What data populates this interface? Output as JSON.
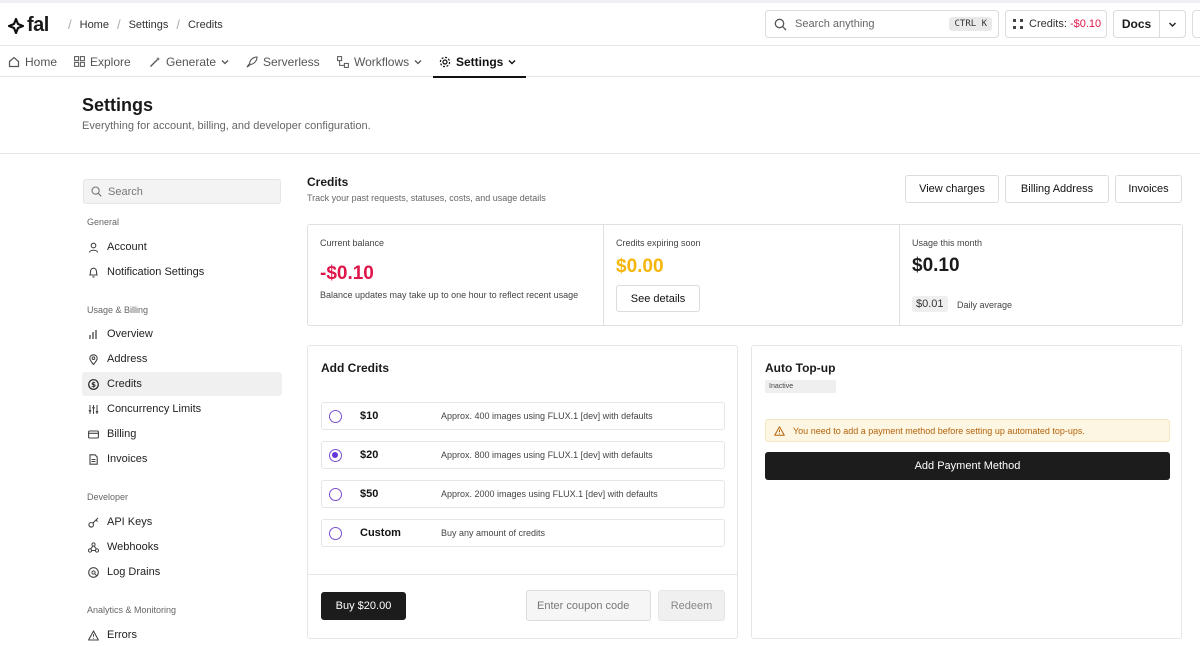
{
  "brand": {
    "name": "fal"
  },
  "breadcrumb": [
    "Home",
    "Settings",
    "Credits"
  ],
  "topbar": {
    "search_placeholder": "Search anything",
    "shortcut": "CTRL K",
    "credits_label": "Credits:",
    "credits_value": "-$0.10",
    "docs_label": "Docs"
  },
  "nav": [
    {
      "label": "Home",
      "icon": "home-icon"
    },
    {
      "label": "Explore",
      "icon": "grid-icon"
    },
    {
      "label": "Generate",
      "icon": "wand-icon",
      "dropdown": true
    },
    {
      "label": "Serverless",
      "icon": "rocket-icon"
    },
    {
      "label": "Workflows",
      "icon": "workflow-icon",
      "dropdown": true
    },
    {
      "label": "Settings",
      "icon": "gear-icon",
      "dropdown": true,
      "active": true
    }
  ],
  "page": {
    "title": "Settings",
    "subtitle": "Everything for account, billing, and developer configuration."
  },
  "sidebar": {
    "search_placeholder": "Search",
    "groups": [
      {
        "label": "General",
        "items": [
          {
            "label": "Account",
            "icon": "user-icon"
          },
          {
            "label": "Notification Settings",
            "icon": "bell-icon"
          }
        ]
      },
      {
        "label": "Usage & Billing",
        "items": [
          {
            "label": "Overview",
            "icon": "bar-chart-icon"
          },
          {
            "label": "Address",
            "icon": "map-pin-icon"
          },
          {
            "label": "Credits",
            "icon": "dollar-circle-icon",
            "active": true
          },
          {
            "label": "Concurrency Limits",
            "icon": "sliders-icon"
          },
          {
            "label": "Billing",
            "icon": "credit-card-icon"
          },
          {
            "label": "Invoices",
            "icon": "file-icon"
          }
        ]
      },
      {
        "label": "Developer",
        "items": [
          {
            "label": "API Keys",
            "icon": "key-icon"
          },
          {
            "label": "Webhooks",
            "icon": "webhook-icon"
          },
          {
            "label": "Log Drains",
            "icon": "log-drain-icon"
          }
        ]
      },
      {
        "label": "Analytics & Monitoring",
        "items": [
          {
            "label": "Errors",
            "icon": "warning-triangle-icon"
          }
        ]
      }
    ]
  },
  "credits": {
    "title": "Credits",
    "subtitle": "Track your past requests, statuses, costs, and usage details",
    "buttons": {
      "view_charges": "View charges",
      "billing_address": "Billing Address",
      "invoices": "Invoices"
    },
    "stats": {
      "balance": {
        "label": "Current balance",
        "value": "-$0.10",
        "note": "Balance updates may take up to one hour to reflect recent usage",
        "color": "#e0164a"
      },
      "expiring": {
        "label": "Credits expiring soon",
        "value": "$0.00",
        "button": "See details",
        "color": "#f5b50a"
      },
      "usage": {
        "label": "Usage this month",
        "value": "$0.10",
        "daily_value": "$0.01",
        "daily_label": "Daily average"
      }
    }
  },
  "add_credits": {
    "title": "Add Credits",
    "options": [
      {
        "amount": "$10",
        "desc": "Approx. 400 images using FLUX.1 [dev] with defaults",
        "selected": false
      },
      {
        "amount": "$20",
        "desc": "Approx. 800 images using FLUX.1 [dev] with defaults",
        "selected": true
      },
      {
        "amount": "$50",
        "desc": "Approx. 2000 images using FLUX.1 [dev] with defaults",
        "selected": false
      },
      {
        "amount": "Custom",
        "desc": "Buy any amount of credits",
        "selected": false
      }
    ],
    "buy_label": "Buy $20.00",
    "coupon_placeholder": "Enter coupon code",
    "redeem_label": "Redeem"
  },
  "auto_topup": {
    "title": "Auto Top-up",
    "status": "Inactive",
    "warning": "You need to add a payment method before setting up automated top-ups.",
    "button": "Add Payment Method"
  },
  "colors": {
    "negative": "#e0164a",
    "warning_text": "#b4630a",
    "accent_radio": "#6a35d6",
    "expiring": "#f5b50a"
  }
}
